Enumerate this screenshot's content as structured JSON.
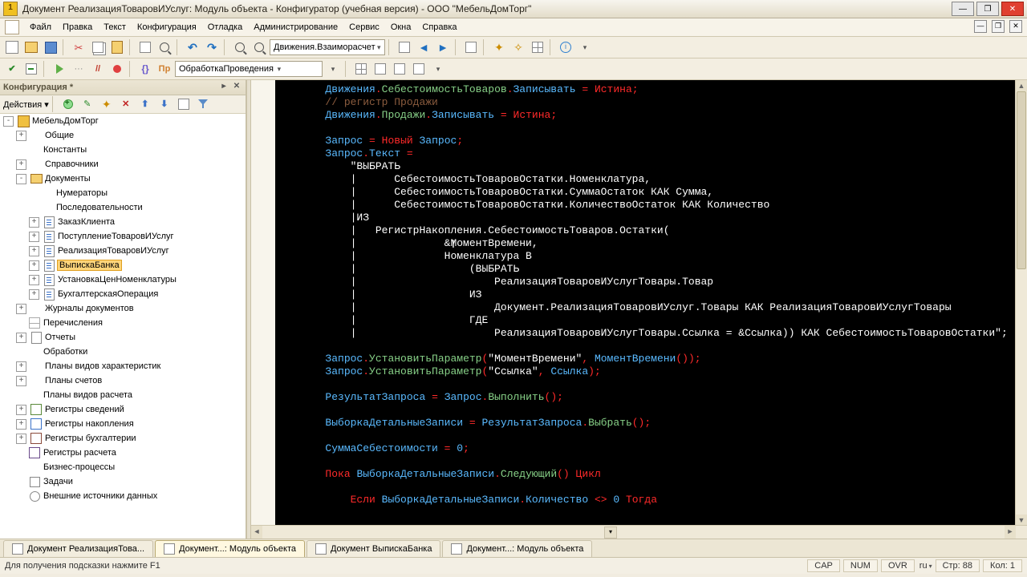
{
  "title": "Документ РеализацияТоваровИУслуг: Модуль объекта - Конфигуратор (учебная версия) - ООО \"МебельДомТорг\"",
  "menu": [
    "Файл",
    "Правка",
    "Текст",
    "Конфигурация",
    "Отладка",
    "Администрирование",
    "Сервис",
    "Окна",
    "Справка"
  ],
  "toolbar1": {
    "combo": "Движения.Взаиморасчет"
  },
  "toolbar2": {
    "combo": "ОбработкаПроведения"
  },
  "cfg": {
    "title": "Конфигурация *",
    "actions_label": "Действия",
    "root": "МебельДомТорг",
    "items": [
      {
        "l": "Общие",
        "d": 1,
        "ic": "ci-cube",
        "tw": "+"
      },
      {
        "l": "Константы",
        "d": 1,
        "ic": "ci-const",
        "tw": "·"
      },
      {
        "l": "Справочники",
        "d": 1,
        "ic": "ci-ref",
        "tw": "+"
      },
      {
        "l": "Документы",
        "d": 1,
        "ic": "ci-folder",
        "tw": "-",
        "exp": true
      },
      {
        "l": "Нумераторы",
        "d": 2,
        "ic": "ci-num",
        "tw": "·"
      },
      {
        "l": "Последовательности",
        "d": 2,
        "ic": "ci-seq",
        "tw": "·"
      },
      {
        "l": "ЗаказКлиента",
        "d": 2,
        "ic": "ci-doc",
        "tw": "+"
      },
      {
        "l": "ПоступлениеТоваровИУслуг",
        "d": 2,
        "ic": "ci-doc",
        "tw": "+"
      },
      {
        "l": "РеализацияТоваровИУслуг",
        "d": 2,
        "ic": "ci-doc",
        "tw": "+"
      },
      {
        "l": "ВыпискаБанка",
        "d": 2,
        "ic": "ci-doc",
        "tw": "+",
        "sel": true
      },
      {
        "l": "УстановкаЦенНоменклатуры",
        "d": 2,
        "ic": "ci-doc",
        "tw": "+"
      },
      {
        "l": "БухгалтерскаяОперация",
        "d": 2,
        "ic": "ci-doc",
        "tw": "+"
      },
      {
        "l": "Журналы документов",
        "d": 1,
        "ic": "ci-journal",
        "tw": "+"
      },
      {
        "l": "Перечисления",
        "d": 1,
        "ic": "ci-enum",
        "tw": "·"
      },
      {
        "l": "Отчеты",
        "d": 1,
        "ic": "ci-report",
        "tw": "+"
      },
      {
        "l": "Обработки",
        "d": 1,
        "ic": "ci-proc",
        "tw": "·"
      },
      {
        "l": "Планы видов характеристик",
        "d": 1,
        "ic": "ci-planchar",
        "tw": "+"
      },
      {
        "l": "Планы счетов",
        "d": 1,
        "ic": "ci-planacc",
        "tw": "+"
      },
      {
        "l": "Планы видов расчета",
        "d": 1,
        "ic": "ci-plancalc",
        "tw": "·"
      },
      {
        "l": "Регистры сведений",
        "d": 1,
        "ic": "ci-reginfo",
        "tw": "+"
      },
      {
        "l": "Регистры накопления",
        "d": 1,
        "ic": "ci-regacc",
        "tw": "+"
      },
      {
        "l": "Регистры бухгалтерии",
        "d": 1,
        "ic": "ci-regbuh",
        "tw": "+"
      },
      {
        "l": "Регистры расчета",
        "d": 1,
        "ic": "ci-regcalc",
        "tw": "·"
      },
      {
        "l": "Бизнес-процессы",
        "d": 1,
        "ic": "ci-bp",
        "tw": "·"
      },
      {
        "l": "Задачи",
        "d": 1,
        "ic": "ci-task",
        "tw": "·"
      },
      {
        "l": "Внешние источники данных",
        "d": 1,
        "ic": "ci-ext",
        "tw": "·"
      }
    ]
  },
  "tabs": [
    {
      "l": "Документ РеализацияТова...",
      "ic": "doc"
    },
    {
      "l": "Документ...: Модуль объекта",
      "ic": "mod",
      "active": true
    },
    {
      "l": "Документ ВыпискаБанка",
      "ic": "doc"
    },
    {
      "l": "Документ...: Модуль объекта",
      "ic": "mod"
    }
  ],
  "status": {
    "hint": "Для получения подсказки нажмите F1",
    "cap": "CAP",
    "num": "NUM",
    "ovr": "OVR",
    "lang": "ru",
    "line_lbl": "Стр:",
    "line": "88",
    "col_lbl": "Кол:",
    "col": "1"
  },
  "code": {
    "c1a": "Движения",
    "c1b": "СебестоимостьТоваров",
    "c1c": "Записывать",
    "c1d": "Истина",
    "c2": "// регистр Продажи",
    "c3a": "Движения",
    "c3b": "Продажи",
    "c3c": "Записывать",
    "c3d": "Истина",
    "c4a": "Запрос",
    "c4b": "Новый",
    "c4c": "Запрос",
    "c5a": "Запрос",
    "c5b": "Текст",
    "s1": "\"ВЫБРАТЬ",
    "s2": "|      СебестоимостьТоваровОстатки.Номенклатура,",
    "s3": "|      СебестоимостьТоваровОстатки.СуммаОстаток КАК Сумма,",
    "s4": "|      СебестоимостьТоваровОстатки.КоличествоОстаток КАК Количество",
    "s5": "|ИЗ",
    "s6": "|   РегистрНакопления.СебестоимостьТоваров.Остатки(",
    "s7": "|              &МоментВремени,",
    "s8": "|              Номенклатура В",
    "s9": "|                  (ВЫБРАТЬ",
    "s10": "|                      РеализацияТоваровИУслугТовары.Товар",
    "s11": "|                  ИЗ",
    "s12": "|                      Документ.РеализацияТоваровИУслуг.Товары КАК РеализацияТоваровИУслугТовары",
    "s13": "|                  ГДЕ",
    "s14": "|                      РеализацияТоваровИУслугТовары.Ссылка = &Ссылка)) КАК СебестоимостьТоваровОстатки\";",
    "p1a": "Запрос",
    "p1b": "УстановитьПараметр",
    "p1s": "\"МоментВремени\"",
    "p1c": "МоментВремени",
    "p2a": "Запрос",
    "p2b": "УстановитьПараметр",
    "p2s": "\"Ссылка\"",
    "p2c": "Ссылка",
    "r1a": "РезультатЗапроса",
    "r1b": "Запрос",
    "r1c": "Выполнить",
    "r2a": "ВыборкаДетальныеЗаписи",
    "r2b": "РезультатЗапроса",
    "r2c": "Выбрать",
    "r3a": "СуммаСебестоимости",
    "r3n": "0",
    "r4a": "Пока",
    "r4b": "ВыборкаДетальныеЗаписи",
    "r4c": "Следующий",
    "r4d": "Цикл",
    "r5a": "Если",
    "r5b": "ВыборкаДетальныеЗаписи",
    "r5c": "Количество",
    "r5n": "0",
    "r5d": "Тогда"
  }
}
